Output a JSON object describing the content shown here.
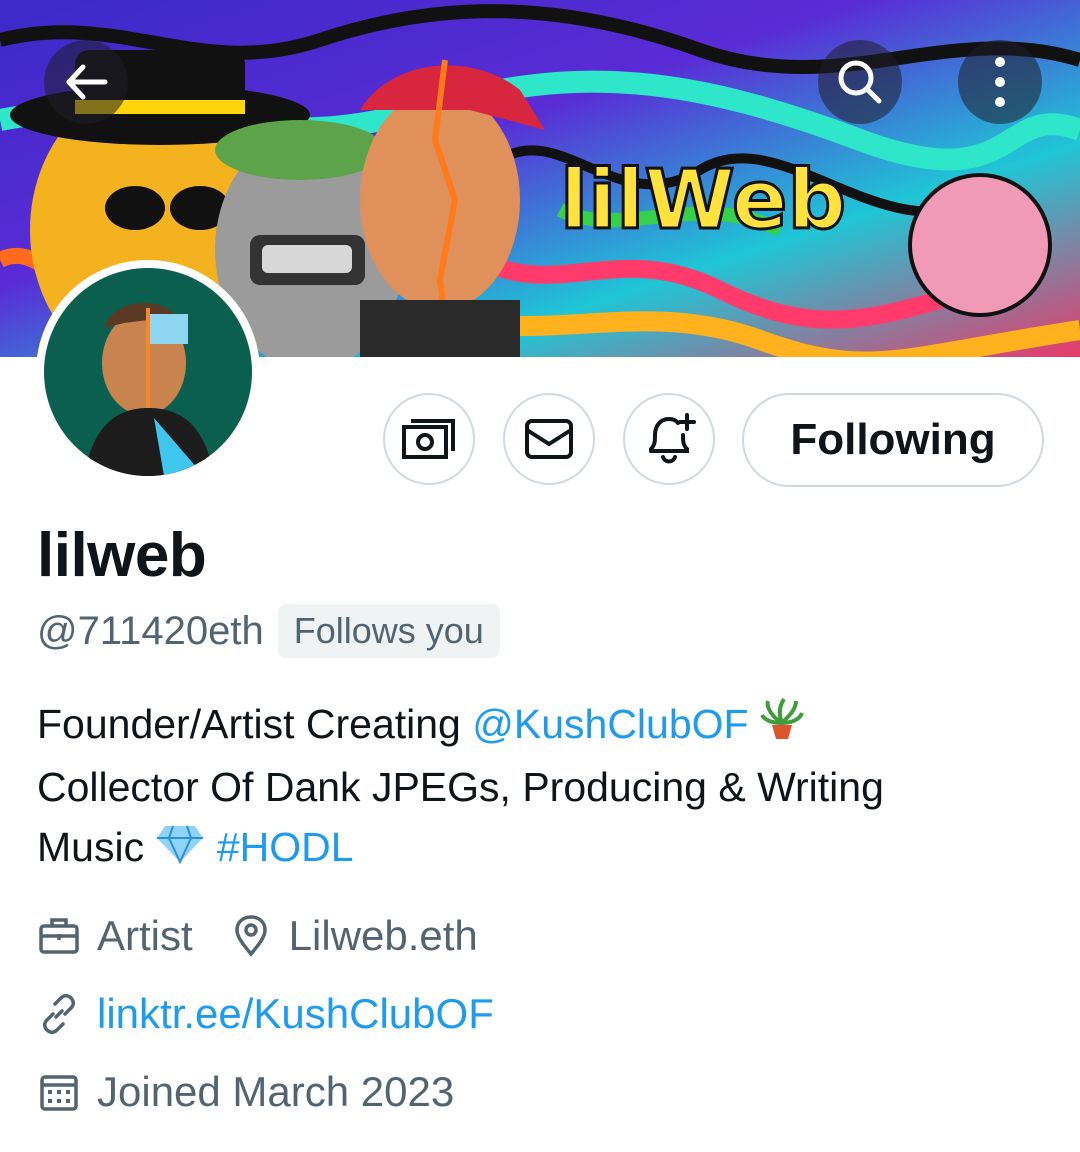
{
  "banner": {
    "logo_text": "lilWeb"
  },
  "top_bar": {
    "back_icon": "arrow-left-icon",
    "search_icon": "search-icon",
    "more_icon": "more-vertical-icon"
  },
  "actions": {
    "tip_icon": "money-icon",
    "message_icon": "mail-icon",
    "notify_icon": "bell-plus-icon",
    "following_label": "Following"
  },
  "profile": {
    "name": "lilweb",
    "handle": "@711420eth",
    "follows_you": "Follows you",
    "bio": {
      "line1_prefix": "Founder/Artist Creating ",
      "line1_mention": "@KushClubOF",
      "line2": "Collector Of Dank JPEGs, Producing & Writing",
      "line3_prefix": "Music ",
      "line3_hashtag": "#HODL"
    },
    "profession": "Artist",
    "location": "Lilweb.eth",
    "website": "linktr.ee/KushClubOF",
    "joined": "Joined March 2023"
  },
  "colors": {
    "link": "#1d9bf0",
    "secondary_text": "#536471",
    "border": "#cfd9de"
  }
}
